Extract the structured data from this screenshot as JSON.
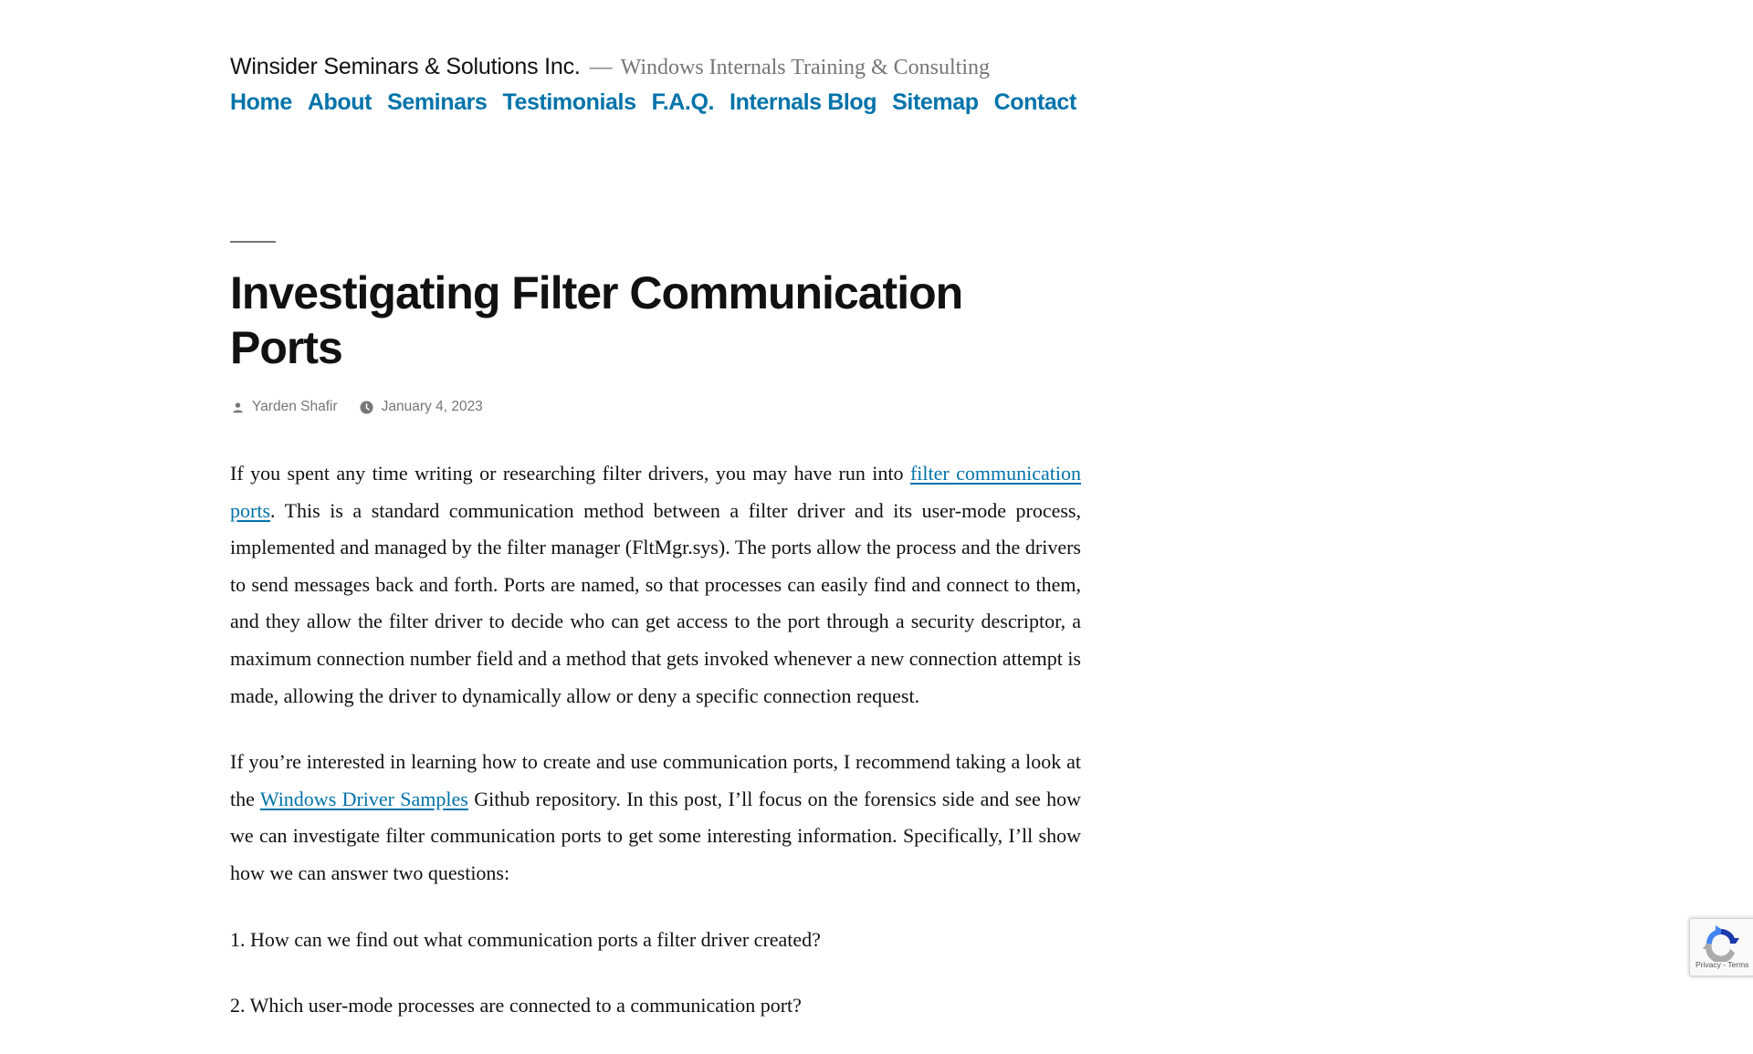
{
  "header": {
    "site_title": "Winsider Seminars & Solutions Inc.",
    "separator": "—",
    "site_description": "Windows Internals Training & Consulting"
  },
  "nav": {
    "items": [
      {
        "label": "Home"
      },
      {
        "label": "About"
      },
      {
        "label": "Seminars"
      },
      {
        "label": "Testimonials"
      },
      {
        "label": "F.A.Q."
      },
      {
        "label": "Internals Blog"
      },
      {
        "label": "Sitemap"
      },
      {
        "label": "Contact"
      }
    ]
  },
  "post": {
    "title": "Investigating Filter Communication Ports",
    "author": "Yarden Shafir",
    "author_icon": "person-icon",
    "date": "January 4, 2023",
    "date_icon": "clock-icon",
    "p1": {
      "before": "If you spent any time writing or researching filter drivers, you may have run into ",
      "link": "filter communication ports",
      "after": ". This is a standard communication method between a filter driver and its user-mode process, implemented and managed by the filter manager (FltMgr.sys). The ports allow the process and the drivers to send messages back and forth. Ports are named, so that processes can easily find and connect to them, and they allow the filter driver to decide who can get access to the port through a security descriptor, a maximum connection number field and a method that gets invoked whenever a new connection attempt is made, allowing the driver to dynamically allow or deny a specific connection request."
    },
    "p2": {
      "before": "If you’re interested in learning how to create and use communication ports, I recommend taking a look at the ",
      "link": "Windows Driver Samples",
      "after": " Github repository. In this post, I’ll focus on the forensics side and see how we can investigate filter communication ports to get some interesting information. Specifically, I’ll show how we can answer two questions:"
    },
    "questions": [
      "1. How can we find out what communication ports a filter driver created?",
      "2. Which user-mode processes are connected to a communication port?"
    ]
  },
  "recaptcha": {
    "links": "Privacy - Terms"
  },
  "colors": {
    "link": "#0073aa",
    "text": "#111111",
    "muted": "#767676"
  }
}
